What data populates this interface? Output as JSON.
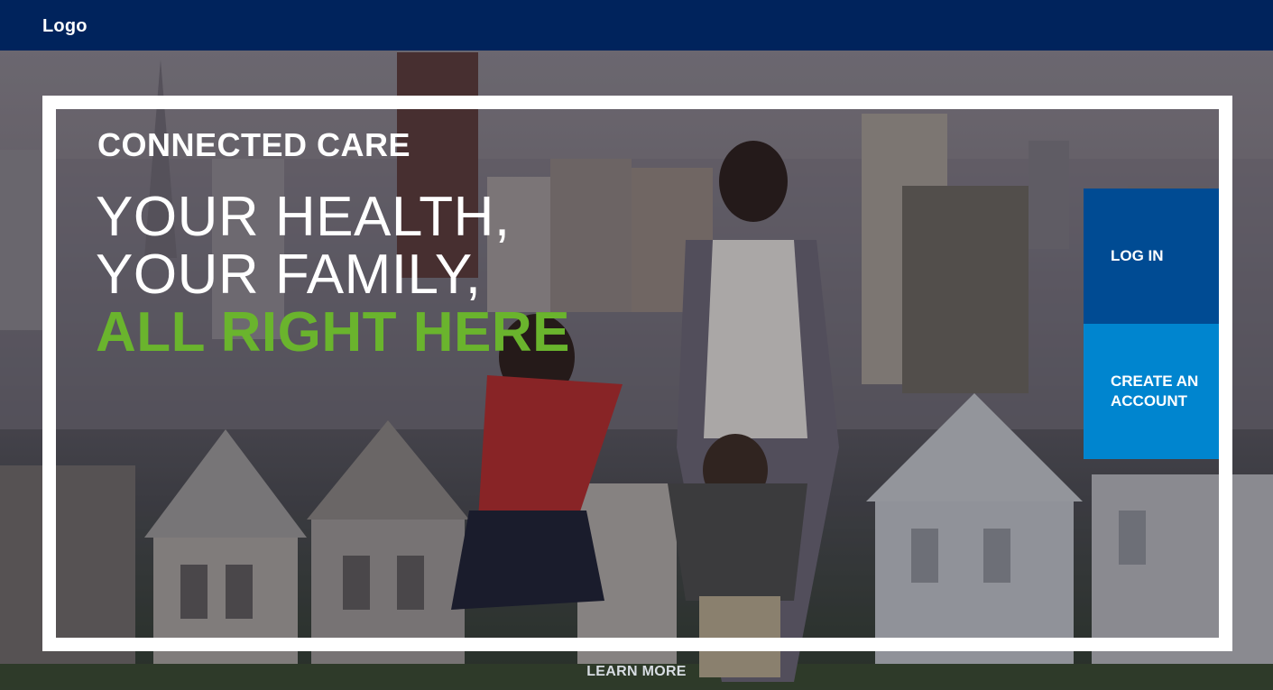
{
  "header": {
    "logo_text": "Logo",
    "background_color": "#00235c"
  },
  "hero": {
    "eyebrow": "CONNECTED CARE",
    "headline": {
      "line1": "YOUR HEALTH,",
      "line2": "YOUR FAMILY,",
      "line3": "ALL RIGHT HERE"
    },
    "accent_color": "#6ab42d",
    "learn_more": "LEARN MORE"
  },
  "actions": {
    "login_label": "LOG IN",
    "create_account_label": "CREATE AN ACCOUNT",
    "login_color": "#004b93",
    "create_account_color": "#0085cf"
  }
}
